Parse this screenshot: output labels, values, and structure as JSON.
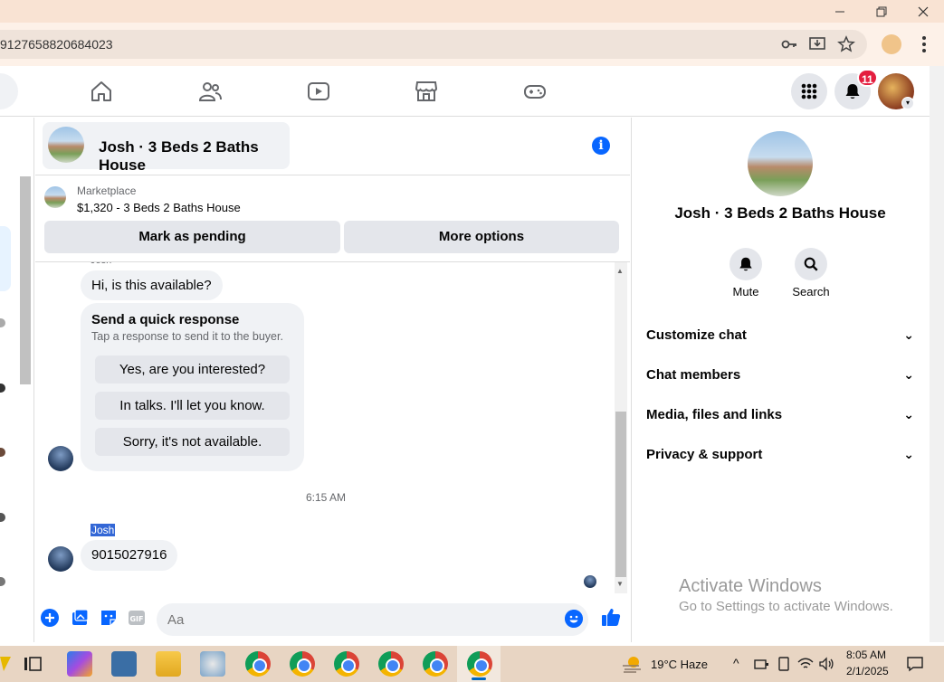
{
  "browser": {
    "url": "9127658820684023"
  },
  "nav": {
    "notifications_badge": "11"
  },
  "chat": {
    "title": "Josh · 3 Beds 2 Baths House",
    "marketplace_label": "Marketplace",
    "listing": "$1,320 - 3 Beds 2 Baths House",
    "mark_pending": "Mark as pending",
    "more_options": "More options",
    "cut_sender": "Josh",
    "msg_available": "Hi, is this available?",
    "quick_title": "Send a quick response",
    "quick_sub": "Tap a response to send it to the buyer.",
    "quick_replies": [
      "Yes, are you interested?",
      "In talks. I'll let you know.",
      "Sorry, it's not available."
    ],
    "timestamp": "6:15 AM",
    "sender_name": "Josh",
    "msg_phone": "9015027916",
    "composer_placeholder": "Aa"
  },
  "panel": {
    "title": "Josh · 3 Beds 2 Baths House",
    "mute": "Mute",
    "search": "Search",
    "rows": [
      "Customize chat",
      "Chat members",
      "Media, files and links",
      "Privacy & support"
    ]
  },
  "watermark": {
    "line1": "Activate Windows",
    "line2": "Go to Settings to activate Windows."
  },
  "taskbar": {
    "weather": "19°C  Haze",
    "time": "8:05 AM",
    "date": "2/1/2025"
  },
  "colors": {
    "accent": "#0866ff",
    "badge": "#e41e3f",
    "selection": "#3367d6"
  }
}
